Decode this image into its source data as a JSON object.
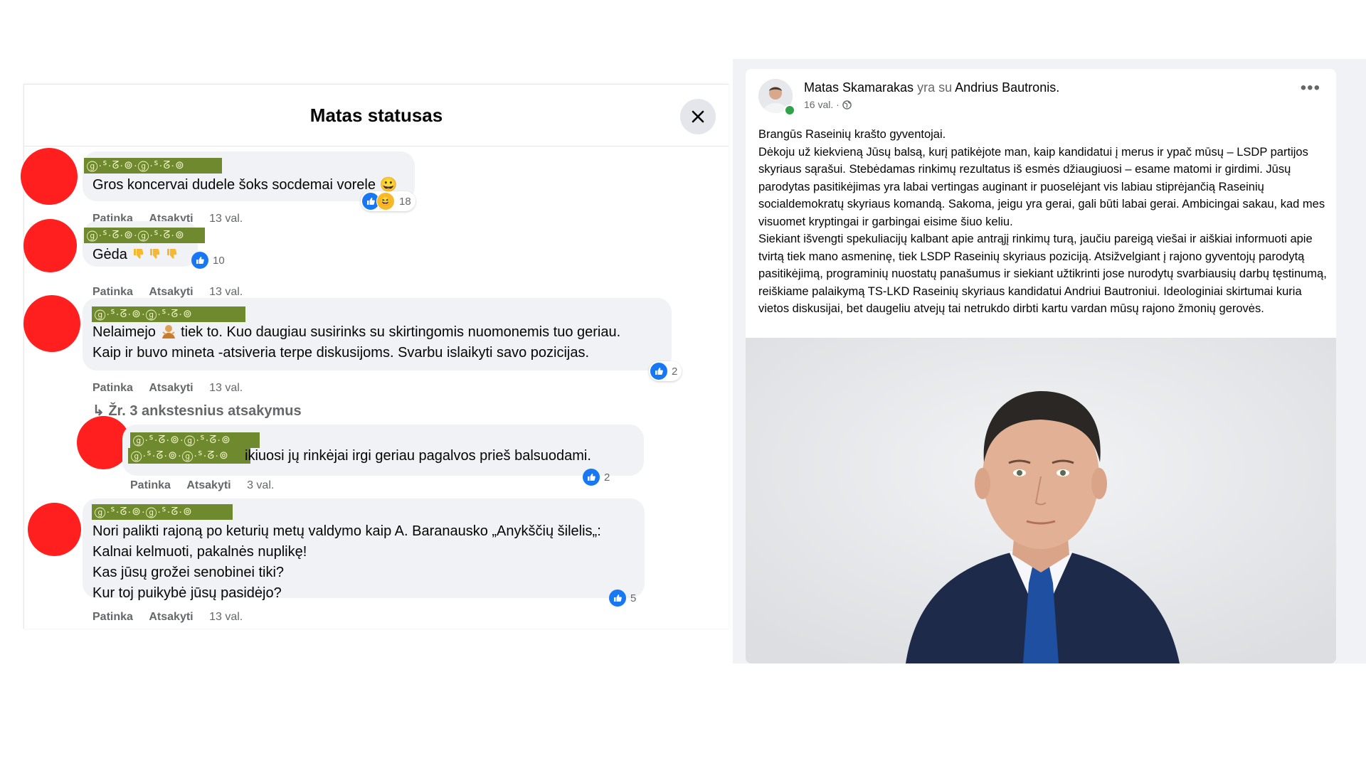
{
  "dialog": {
    "title": "Matas statusas",
    "close_label": "×"
  },
  "actions": {
    "like": "Patinka",
    "reply": "Atsakyti"
  },
  "name_mask": "ⓖ·ᔆ·ᘔ·⊚·ⓖ·ᔆ·ᘔ·⊚",
  "comments": [
    {
      "text_lines": [
        "Gros koncervai dudele šoks socdemai vorele 😀"
      ],
      "reactions": "18",
      "time": "13 val."
    },
    {
      "text_lines": [
        "Gėda"
      ],
      "reactions": "10",
      "time": "13 val."
    },
    {
      "text_lines": [
        "Nelaimejo",
        "tiek to. Kuo daugiau susirinks su skirtingomis nuomonemis tuo geriau.",
        "Kaip ir buvo mineta -atsiveria terpe diskusijoms. Svarbu islaikyti savo pozicijas."
      ],
      "reactions": "2",
      "time": "13 val."
    },
    {
      "text_lines": [
        "ikiuosi jų rinkėjai irgi geriau pagalvos prieš balsuodami."
      ],
      "reactions": "2",
      "time": "3 val."
    },
    {
      "text_lines": [
        "Nori palikti rajoną po keturių metų valdymo kaip A. Baranausko „Anykščių šilelis„:",
        "Kalnai kelmuoti, pakalnės nuplikę!",
        "Kas jūsų grožei senobinei tiki?",
        "Kur toj puikybė jūsų pasidėjo?"
      ],
      "reactions": "5",
      "time": "13 val."
    }
  ],
  "previous_replies": "Žr. 3 ankstesnius atsakymus",
  "post": {
    "author": "Matas Skamarakas",
    "with_word": "yra su",
    "tagged": "Andrius Bautronis.",
    "time": "16 val. ·",
    "more": "•••",
    "paragraphs": [
      "Brangūs Raseinių krašto gyventojai.",
      "Dėkoju už kiekvieną Jūsų balsą, kurį patikėjote man, kaip kandidatui į merus ir ypač mūsų – LSDP partijos skyriaus sąrašui. Stebėdamas rinkimų rezultatus iš esmės džiaugiuosi – esame matomi ir girdimi. Jūsų parodytas pasitikėjimas yra labai vertingas auginant ir puoselėjant vis labiau stiprėjančią Raseinių socialdemokratų skyriaus komandą. Sakoma, jeigu yra gerai, gali būti labai gerai. Ambicingai sakau, kad mes visuomet kryptingai ir garbingai eisime šiuo keliu.",
      "Siekiant išvengti spekuliacijų kalbant apie antrąjį rinkimų turą, jaučiu pareigą viešai ir aiškiai informuoti apie tvirtą tiek mano asmeninę, tiek LSDP Raseinių skyriaus poziciją. Atsižvelgiant į rajono gyventojų parodytą pasitikėjimą, programinių nuostatų panašumus ir siekiant užtikrinti jose nurodytų svarbiausių darbų tęstinumą, reiškiame palaikymą TS-LKD Raseinių skyriaus kandidatui Andriui Bautroniui. Ideologiniai skirtumai kuria vietos diskusijai, bet daugeliu atvejų tai netrukdo dirbti kartu vardan mūsų rajono žmonių gerovės."
    ]
  },
  "colors": {
    "accent": "#1877f2",
    "mask_bg": "#6f8a2e",
    "avatar_cover": "#ff1f1f"
  }
}
